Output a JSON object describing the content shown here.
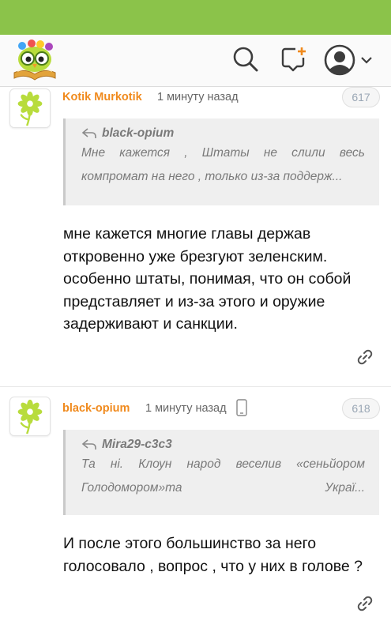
{
  "header": {
    "logo_icon": "owl-books-logo",
    "search_icon": "search-icon",
    "add_post_icon": "add-message-icon",
    "avatar_icon": "user-avatar-icon",
    "dropdown_icon": "chevron-down-icon",
    "colors": {
      "topbar": "#8bc34a",
      "icon": "#3d3d3d"
    }
  },
  "comments": [
    {
      "author": "Kotik Murkotik",
      "time": "1 минуту назад",
      "number": "617",
      "quote": {
        "author": "black-opium",
        "line1": [
          "Мне",
          "кажется",
          ",",
          "Штаты",
          "не",
          "слили",
          "весь"
        ],
        "line2": "компромат на него , только из-за поддерж..."
      },
      "text": [
        "мне кажется многие главы держав",
        "откровенно уже брезгуют зеленским.",
        "особенно штаты, понимая, что он собой",
        "представляет и из-за этого и оружие",
        "задерживают и санкции."
      ]
    },
    {
      "author": "black-opium",
      "time": "1 минуту назад",
      "device_icon": "mobile-phone-icon",
      "number": "618",
      "quote": {
        "author": "Mira29-c3c3",
        "line1": [
          "Та",
          "ні.",
          "Клоун",
          "народ",
          "веселив",
          "«сеньйором"
        ],
        "line2_left": "Голодомором»та",
        "line2_right": "Украї..."
      },
      "text": [
        "И после этого большинство за него",
        "голосовало , вопрос , что у них в голове ?"
      ]
    }
  ],
  "accent_color": "#f08a1d"
}
